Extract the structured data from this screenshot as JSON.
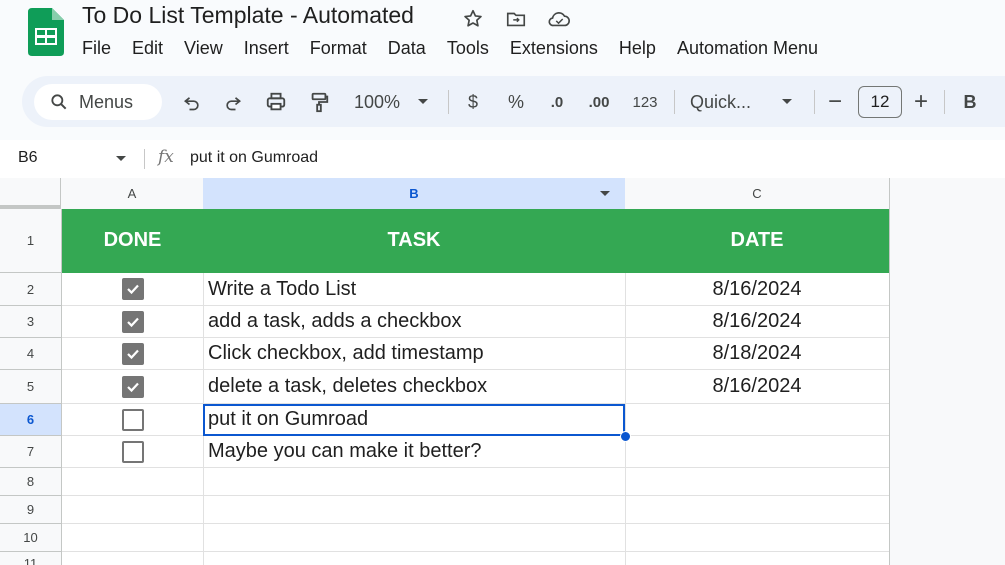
{
  "app": {
    "title": "To Do List Template - Automated"
  },
  "menu": [
    "File",
    "Edit",
    "View",
    "Insert",
    "Format",
    "Data",
    "Tools",
    "Extensions",
    "Help",
    "Automation Menu"
  ],
  "toolbar": {
    "search_label": "Menus",
    "zoom": "100%",
    "currency": "$",
    "percent": "%",
    "decrease_decimal": ".0",
    "increase_decimal": ".00",
    "number_format": "123",
    "font": "Quick...",
    "minus": "−",
    "font_size": "12",
    "plus": "+",
    "bold": "B"
  },
  "formula_bar": {
    "cell_ref": "B6",
    "fx": "fx",
    "content": "put it on Gumroad"
  },
  "columns": [
    "A",
    "B",
    "C"
  ],
  "rows": [
    "1",
    "2",
    "3",
    "4",
    "5",
    "6",
    "7",
    "8",
    "9",
    "10",
    "11"
  ],
  "header": {
    "done": "DONE",
    "task": "TASK",
    "date": "DATE"
  },
  "tasks": [
    {
      "done": true,
      "task": "Write a Todo List",
      "date": "8/16/2024"
    },
    {
      "done": true,
      "task": "add a task, adds a checkbox",
      "date": "8/16/2024"
    },
    {
      "done": true,
      "task": "Click checkbox, add timestamp",
      "date": "8/18/2024"
    },
    {
      "done": true,
      "task": "delete a task, deletes checkbox",
      "date": "8/16/2024"
    },
    {
      "done": false,
      "task": "put it on Gumroad",
      "date": ""
    },
    {
      "done": false,
      "task": "Maybe you can make it better?",
      "date": ""
    }
  ],
  "selected_cell": "B6",
  "colors": {
    "header_green": "#34a853",
    "selection_blue": "#0b57d0",
    "logo_green": "#0f9d58"
  }
}
